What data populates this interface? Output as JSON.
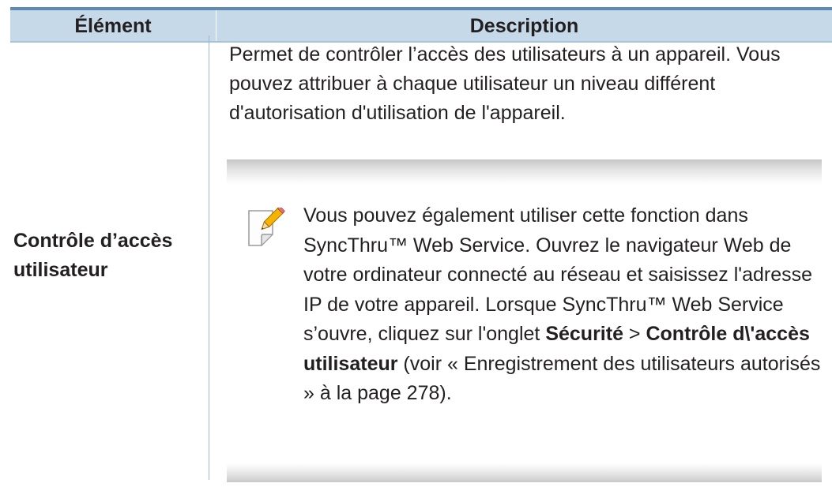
{
  "table": {
    "headers": [
      "Élément",
      "Description"
    ],
    "rows": [
      {
        "item": "Contrôle d’accès utilisateur",
        "description": "Permet de contrôler l’accès des utilisateurs à un appareil. Vous pouvez attribuer à chaque utilisateur un niveau différent d'autorisation d'utilisation de l'appareil.",
        "note": {
          "icon": "note-pencil-icon",
          "text_before": "Vous pouvez également utiliser cette fonction dans SyncThru™ Web Service. Ouvrez le navigateur Web de votre ordinateur connecté au réseau et saisissez l'adresse IP de votre appareil. Lorsque SyncThru™ Web Service s’ouvre, cliquez sur l'onglet ",
          "bold_1": "Sécurité",
          "separator": " > ",
          "bold_2": "Contrôle d\\'accès utilisateur",
          "text_after": " (voir « Enregistrement des utilisateurs autorisés » à la page 278)."
        }
      }
    ]
  },
  "colors": {
    "header_bg": "#c5d9e9",
    "top_rule": "#5f8bb2",
    "column_rule": "#9cb8d2"
  }
}
